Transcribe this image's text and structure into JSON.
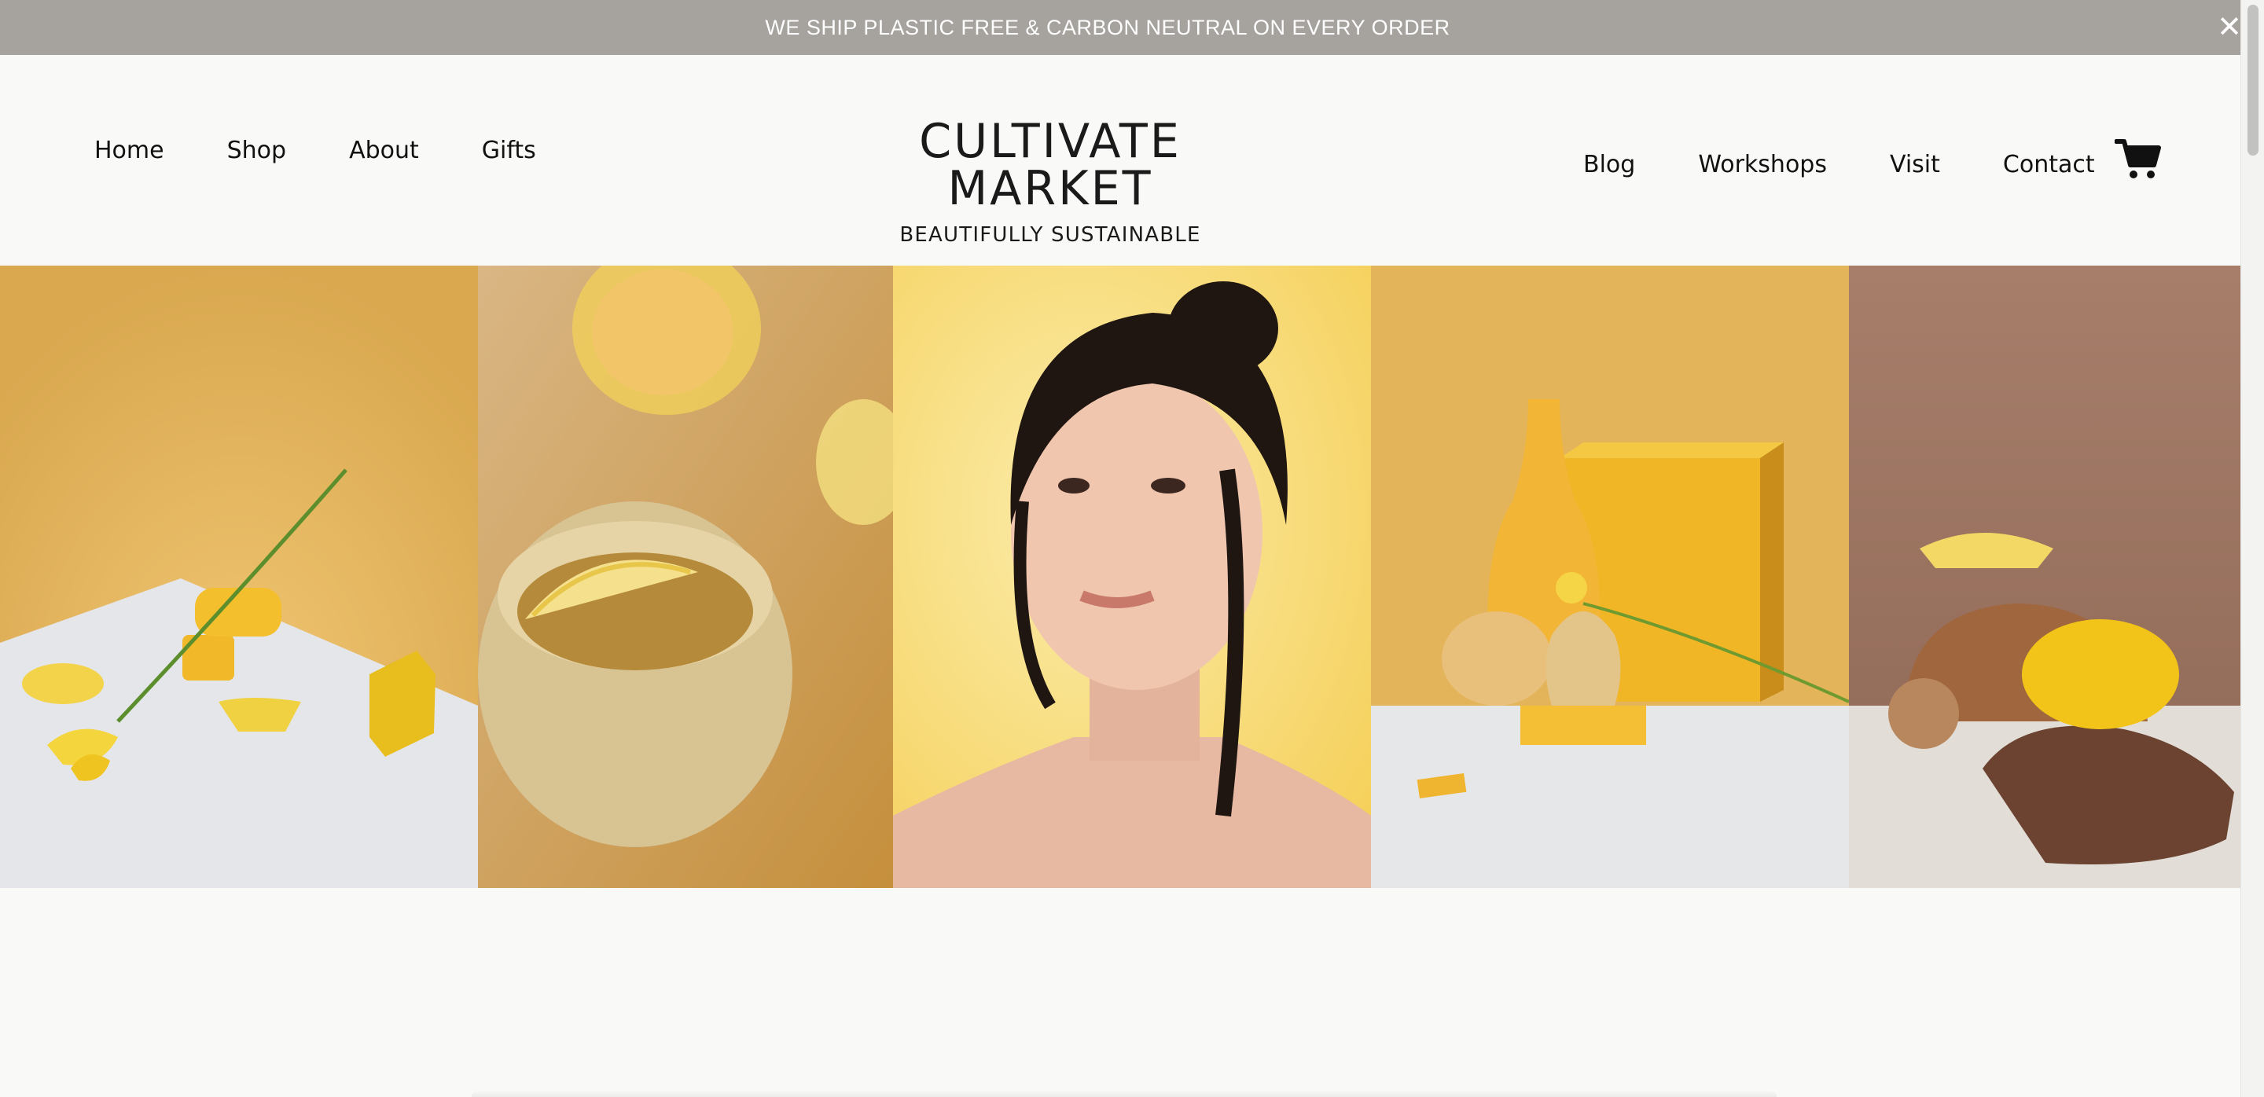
{
  "announcement": {
    "text": "WE SHIP PLASTIC FREE & CARBON NEUTRAL ON EVERY ORDER",
    "close_icon": "close-icon"
  },
  "header": {
    "nav_left": [
      "Home",
      "Shop",
      "About",
      "Gifts"
    ],
    "nav_right": [
      "Blog",
      "Workshops",
      "Visit",
      "Contact"
    ],
    "logo_title": "CULTIVATE MARKET",
    "logo_subtitle": "BEAUTIFULLY SUSTAINABLE",
    "cart_icon": "shopping-cart-icon"
  },
  "gallery": {
    "images": [
      "yellow geometric shapes with flower",
      "ceramic cup with lemon slice",
      "woman portrait on yellow background",
      "yellow vases and box with flower",
      "wooden shapes with lemons on sand"
    ]
  },
  "colors": {
    "announcement_bg": "#a6a29e",
    "page_bg": "#f9f9f7",
    "text": "#111111",
    "accent_yellow": "#e3b24c"
  }
}
